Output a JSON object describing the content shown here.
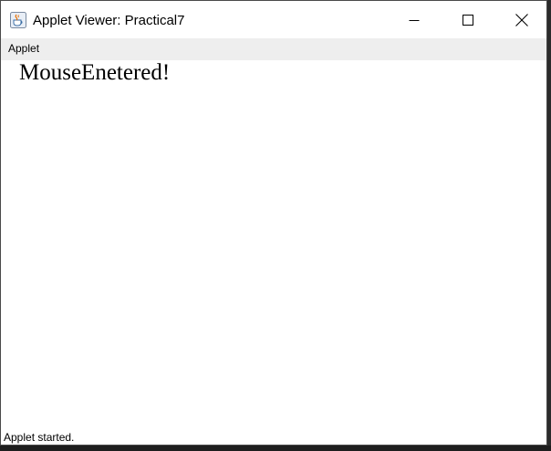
{
  "window": {
    "title": "Applet Viewer: Practical7",
    "icon": "java-cup-icon"
  },
  "controls": {
    "minimize_icon": "minimize-icon",
    "maximize_icon": "maximize-icon",
    "close_icon": "close-icon"
  },
  "menubar": {
    "items": [
      {
        "label": "Applet"
      }
    ]
  },
  "applet": {
    "message": "MouseEnetered!"
  },
  "status": {
    "text": "Applet started."
  },
  "colors": {
    "title_bg": "#ffffff",
    "menubar_bg": "#eeeeee",
    "canvas_bg": "#ffffff",
    "backdrop": "#1e1e1e"
  }
}
